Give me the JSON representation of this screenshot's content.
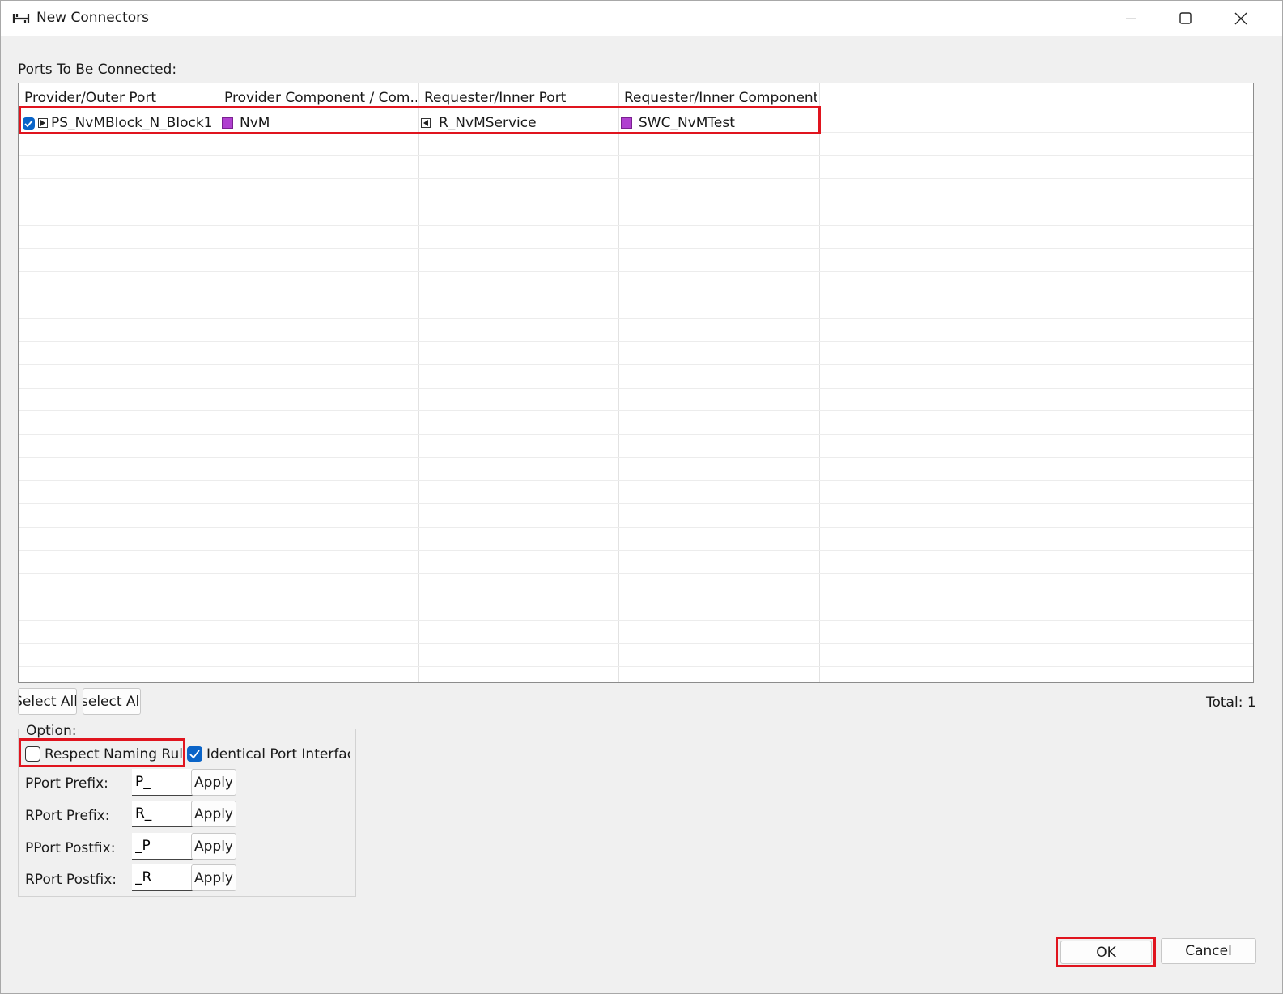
{
  "window": {
    "title": "New Connectors",
    "title_icon": "connector-icon",
    "controls": [
      "minimize-icon",
      "maximize-icon",
      "close-icon"
    ]
  },
  "ports_label": "Ports To Be Connected:",
  "table": {
    "headers": [
      "Provider/Outer Port",
      "Provider Component / Com...",
      "Requester/Inner Port",
      "Requester/Inner Component"
    ],
    "rows": [
      {
        "checked": true,
        "provider_port": "PS_NvMBlock_N_Block1",
        "provider_component": "NvM",
        "requester_port": "R_NvMService",
        "requester_component": "SWC_NvMTest"
      }
    ]
  },
  "buttons": {
    "select_all": "Select All",
    "deselect_all": "Deselect All",
    "ok": "OK",
    "cancel": "Cancel"
  },
  "total_text": "Total: 1",
  "options": {
    "legend": "Option:",
    "respect_naming_rule": {
      "label": "Respect Naming Rule",
      "checked": false
    },
    "identical_port_interface": {
      "label": "Identical Port Interface",
      "checked": true
    },
    "pport_prefix": {
      "label": "PPort Prefix:",
      "value": "P_",
      "apply": "Apply"
    },
    "rport_prefix": {
      "label": "RPort Prefix:",
      "value": "R_",
      "apply": "Apply"
    },
    "pport_postfix": {
      "label": "PPort Postfix:",
      "value": "_P",
      "apply": "Apply"
    },
    "rport_postfix": {
      "label": "RPort Postfix:",
      "value": "_R",
      "apply": "Apply"
    }
  },
  "colors": {
    "highlight": "#e0141e",
    "checkbox_checked": "#0a64c8",
    "component_icon": "#b040d0"
  }
}
